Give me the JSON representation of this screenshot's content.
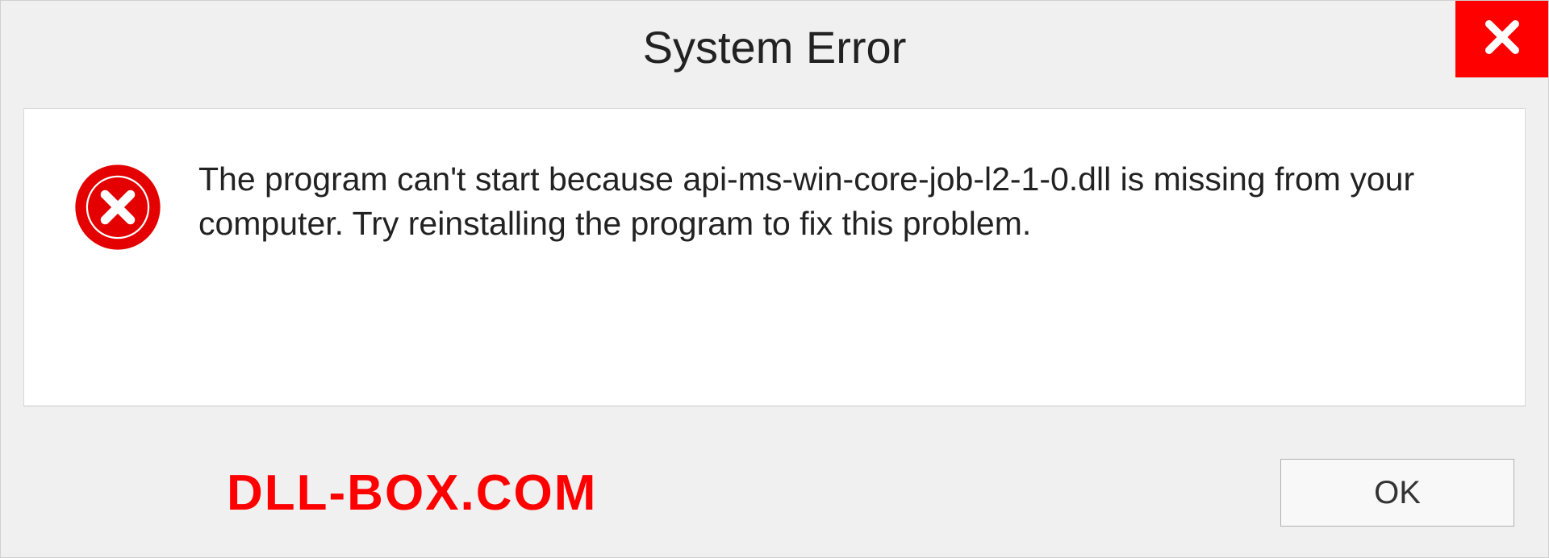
{
  "dialog": {
    "title": "System Error",
    "message": "The program can't start because api-ms-win-core-job-l2-1-0.dll is missing from your computer. Try reinstalling the program to fix this problem.",
    "ok_label": "OK"
  },
  "watermark": "DLL-BOX.COM",
  "colors": {
    "accent_red": "#ff0000",
    "background": "#f0f0f0",
    "panel": "#ffffff"
  }
}
